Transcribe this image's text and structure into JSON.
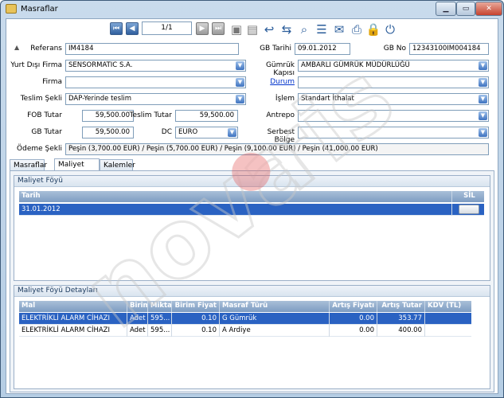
{
  "window": {
    "title": "Masraflar"
  },
  "toolbar": {
    "page": "1/1"
  },
  "form": {
    "referans": {
      "label": "Referans",
      "value": "IM4184"
    },
    "gb_tarihi": {
      "label": "GB Tarihi",
      "value": "09.01.2012"
    },
    "gb_no": {
      "label": "GB No",
      "value": "12343100IM004184"
    },
    "yurt_disi_firma": {
      "label": "Yurt Dışı Firma",
      "value": "SENSORMATIC S.A."
    },
    "gumruk_kapisi": {
      "label": "Gümrük Kapısı",
      "value": "AMBARLI GÜMRÜK MÜDÜRLÜĞÜ"
    },
    "firma": {
      "label": "Firma",
      "value": ""
    },
    "durum": {
      "label": "Durum",
      "value": ""
    },
    "teslim_sekli": {
      "label": "Teslim Şekli",
      "value": "DAP-Yerinde teslim"
    },
    "islem": {
      "label": "İşlem",
      "value": "Standart İthalat"
    },
    "fob_tutar": {
      "label": "FOB Tutar",
      "value": "59,500.00"
    },
    "teslim_tutar": {
      "label": "Teslim Tutar",
      "value": "59,500.00"
    },
    "antrepo": {
      "label": "Antrepo",
      "value": ""
    },
    "gb_tutar": {
      "label": "GB Tutar",
      "value": "59,500.00"
    },
    "dc": {
      "label": "DC",
      "value": "EURO"
    },
    "serbest_bolge": {
      "label": "Serbest Bölge",
      "value": ""
    },
    "odeme_sekli": {
      "label": "Ödeme Şekli",
      "value": "Peşin (3,700.00 EUR) / Peşin (5,700.00 EUR) / Peşin (9,100.00 EUR) / Peşin (41,000.00 EUR)"
    }
  },
  "tabs": [
    {
      "label": "Masraflar"
    },
    {
      "label": "Maliyet Föyü"
    },
    {
      "label": "Kalemler"
    }
  ],
  "maliyet_foyu": {
    "group_title": "Maliyet Föyü",
    "columns": {
      "tarih": "Tarih",
      "sil": "SİL"
    },
    "rows": [
      {
        "tarih": "31.01.2012"
      }
    ]
  },
  "detaylar": {
    "group_title": "Maliyet Föyü Detayları",
    "columns": {
      "mal": "Mal",
      "birim": "Birim",
      "miktar": "Miktar",
      "birim_fiyat": "Birim Fiyat",
      "masraf_turu": "Masraf Türü",
      "artis_fiyati": "Artış Fiyatı",
      "artis_tutar": "Artış Tutar",
      "kdv": "KDV (TL)"
    },
    "rows": [
      {
        "mal": "ELEKTRİKLİ ALARM CİHAZI",
        "birim": "Adet",
        "miktar": "595...",
        "birim_fiyat": "0.10",
        "masraf_turu": "G Gümrük",
        "artis_fiyati": "0.00",
        "artis_tutar": "353.77",
        "kdv": ""
      },
      {
        "mal": "ELEKTRİKLİ ALARM CİHAZI",
        "birim": "Adet",
        "miktar": "595...",
        "birim_fiyat": "0.10",
        "masraf_turu": "A Ardiye",
        "artis_fiyati": "0.00",
        "artis_tutar": "400.00",
        "kdv": ""
      }
    ]
  },
  "colors": {
    "accent": "#2a62c2",
    "link": "#0033cc",
    "watermark": "#c8c8c8",
    "watermark_dot": "#e04040"
  }
}
